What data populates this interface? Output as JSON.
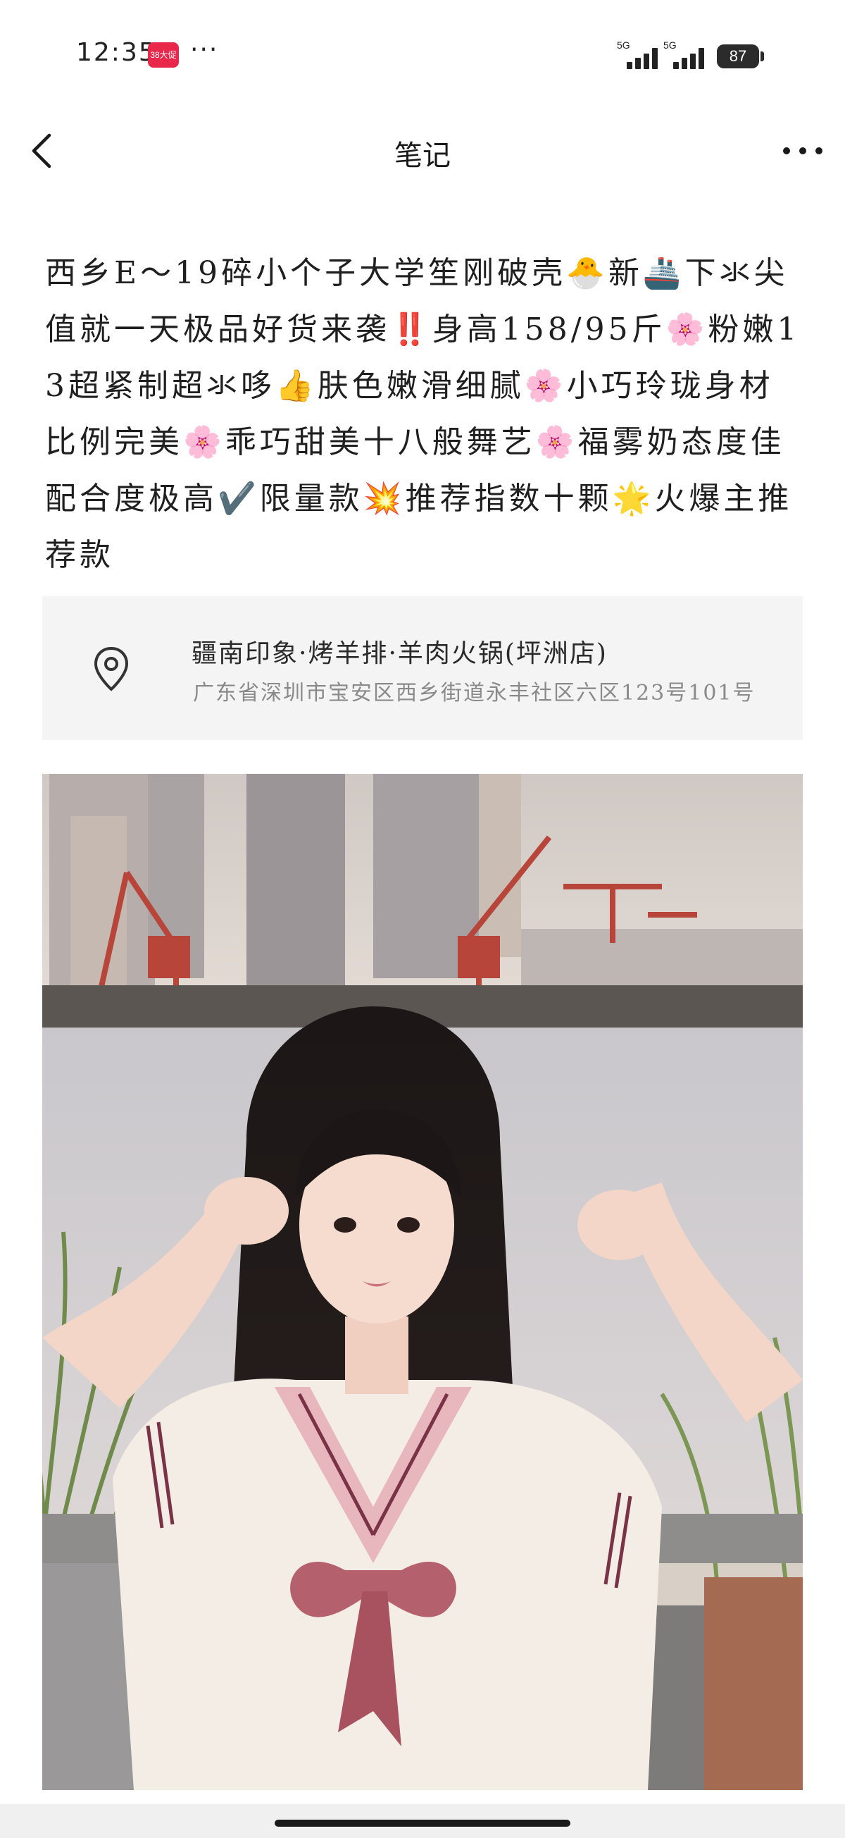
{
  "status_bar": {
    "time": "12:35",
    "app_badge": "38大促",
    "more": "···",
    "sim1": "5G",
    "sim2": "5G",
    "battery": "87"
  },
  "header": {
    "title": "笔记",
    "back_icon": "chevron-left-icon",
    "more_icon": "more-horizontal-icon"
  },
  "note": {
    "text": "西乡E～19碎小个子大学笙刚破壳🐣新🚢下氺尖值就一天极品好货来袭‼️身高158/95斤🌸粉嫩13超紧制超氺哆👍肤色嫩滑细腻🌸小巧玲珑身材比例完美🌸乖巧甜美十八般舞艺🌸福雾奶态度佳配合度极高✔️限量款💥推荐指数十颗🌟火爆主推荐款"
  },
  "location": {
    "icon": "location-pin-icon",
    "name": "疆南印象·烤羊排·羊肉火锅(坪洲店)",
    "address": "广东省深圳市宝安区西乡街道永丰社区六区123号101号"
  },
  "photo": {
    "description_icon": "photo"
  }
}
